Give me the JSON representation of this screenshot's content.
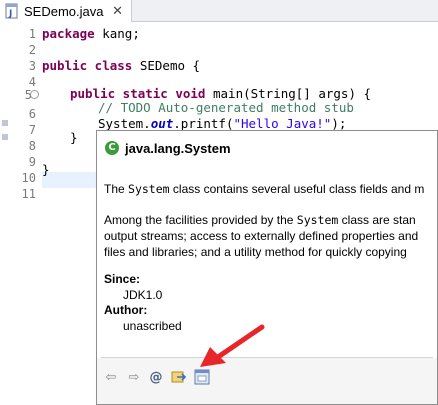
{
  "tab": {
    "label": "SEDemo.java",
    "close": "✕"
  },
  "gutter": [
    "1",
    "2",
    "3",
    "4",
    "5",
    "6",
    "7",
    "8",
    "9",
    "10",
    "11"
  ],
  "code": {
    "l1_kw": "package",
    "l1_rest": " kang;",
    "l3_kw": "public class",
    "l3_rest": " SEDemo {",
    "l5_kw": "public static void",
    "l5_rest": " main(String[] args) {",
    "l6_comment": "// TODO Auto-generated method stub",
    "l7_a": "System.",
    "l7_field": "out",
    "l7_b": ".printf(",
    "l7_str": "\"Hello Java!\"",
    "l7_c": ");",
    "l8": "}",
    "l10": "}"
  },
  "hover": {
    "class_icon": "C",
    "title": "java.lang.System",
    "p1_a": "The ",
    "p1_code": "System",
    "p1_b": " class contains several useful class fields and m",
    "p2_a": "Among the facilities provided by the ",
    "p2_code": "System",
    "p2_b": " class are stan",
    "p2_line2": "output streams; access to externally defined properties and",
    "p2_line3": "files and libraries; and a utility method for quickly copying",
    "since_label": "Since:",
    "since_value": "JDK1.0",
    "author_label": "Author:",
    "author_value": "unascribed",
    "toolbar": {
      "back": "⇦",
      "forward": "⇨",
      "attach": "@",
      "open_declaration": "open-declaration-icon",
      "show_in_javadoc_view": "javadoc-view-icon"
    }
  },
  "colors": {
    "keyword": "#7f0055",
    "comment": "#3f7f5f",
    "string": "#2a00ff",
    "field": "#0000c0",
    "annotation_arrow": "#e8262a"
  }
}
